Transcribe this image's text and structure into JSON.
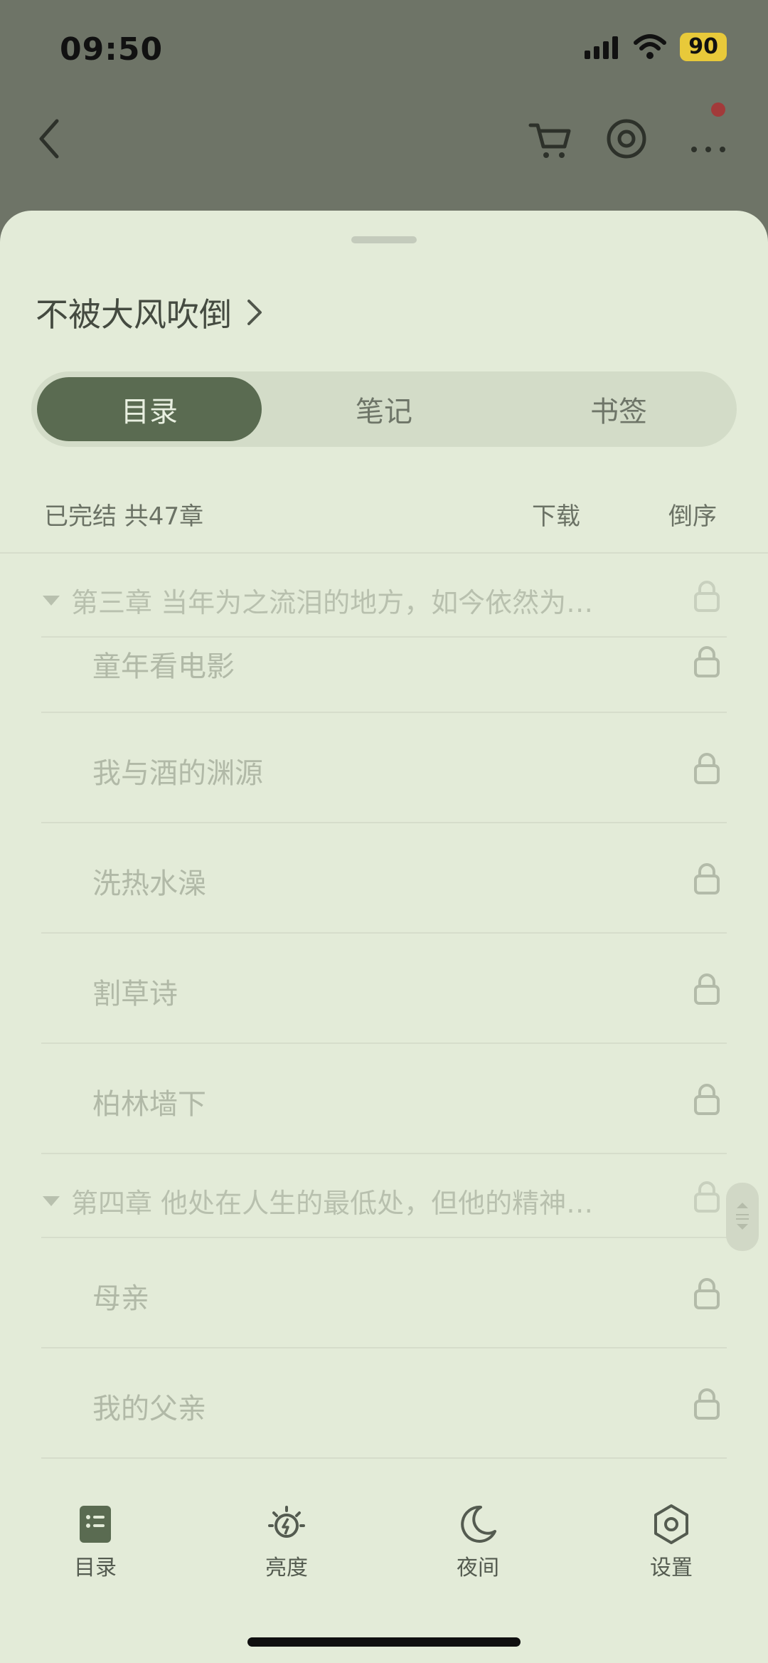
{
  "status_bar": {
    "time": "09:50",
    "battery": "90"
  },
  "book": {
    "title": "不被大风吹倒"
  },
  "tabs": [
    {
      "label": "目录",
      "active": true
    },
    {
      "label": "笔记",
      "active": false
    },
    {
      "label": "书签",
      "active": false
    }
  ],
  "info": {
    "status": "已完结 共47章",
    "download": "下载",
    "reverse": "倒序"
  },
  "chapters": {
    "ch3_title": "第三章 当年为之流泪的地方，如今依然为…",
    "ch3_items": [
      "童年看电影",
      "我与酒的渊源",
      "洗热水澡",
      "割草诗",
      "柏林墙下"
    ],
    "ch4_title": "第四章 他处在人生的最低处，但他的精神…",
    "ch4_items": [
      "母亲",
      "我的父亲"
    ]
  },
  "bottom_bar": {
    "toc": "目录",
    "brightness": "亮度",
    "night": "夜间",
    "settings": "设置"
  },
  "colors": {
    "accent": "#5a6b51",
    "sheet_bg": "#e3ebd8",
    "badge_red": "#a23a3a"
  }
}
